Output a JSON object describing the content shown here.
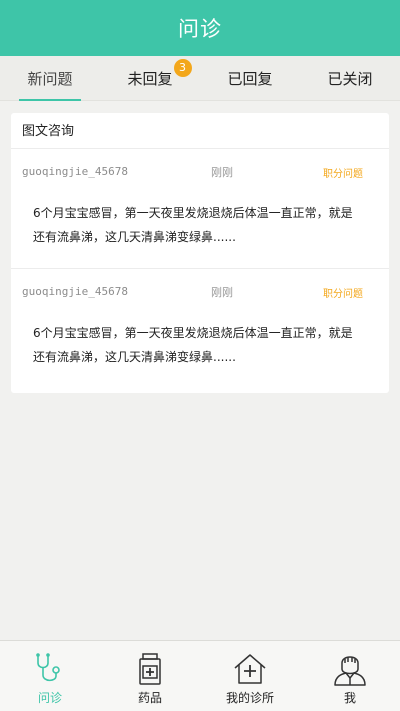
{
  "header": {
    "title": "问诊"
  },
  "tabs": [
    {
      "label": "新问题"
    },
    {
      "label": "未回复",
      "badge": "3"
    },
    {
      "label": "已回复"
    },
    {
      "label": "已关闭"
    }
  ],
  "section": {
    "title": "图文咨询"
  },
  "questions": [
    {
      "user": "guoqingjie_45678",
      "time": "刚刚",
      "tag": "职分问题",
      "content": "6个月宝宝感冒，第一天夜里发烧退烧后体温一直正常，就是还有流鼻涕，这几天清鼻涕变绿鼻......"
    },
    {
      "user": "guoqingjie_45678",
      "time": "刚刚",
      "tag": "职分问题",
      "content": "6个月宝宝感冒，第一天夜里发烧退烧后体温一直正常，就是还有流鼻涕，这几天清鼻涕变绿鼻......"
    }
  ],
  "nav": [
    {
      "label": "问诊",
      "icon": "stethoscope-icon"
    },
    {
      "label": "药品",
      "icon": "medicine-bottle-icon"
    },
    {
      "label": "我的诊所",
      "icon": "clinic-house-icon"
    },
    {
      "label": "我",
      "icon": "doctor-avatar-icon"
    }
  ],
  "colors": {
    "accent": "#3ec5a8",
    "badge": "#f3a71b",
    "tag": "#f3a71b"
  }
}
